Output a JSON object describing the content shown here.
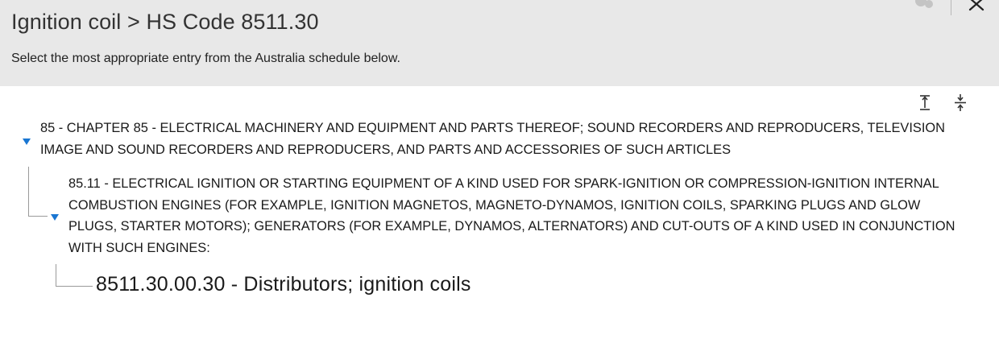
{
  "header": {
    "title": "Ignition coil > HS Code 8511.30",
    "subtitle": "Select the most appropriate entry from the Australia schedule below."
  },
  "icons": {
    "help": "help-icon",
    "close": "close-icon",
    "expand_all": "expand-all-icon",
    "collapse_all": "collapse-all-icon",
    "tree_toggle": "caret-down-icon"
  },
  "tree": {
    "chapter": {
      "label": "85 - CHAPTER 85 - ELECTRICAL MACHINERY AND EQUIPMENT AND PARTS THEREOF; SOUND RECORDERS AND REPRODUCERS, TELEVISION IMAGE AND SOUND RECORDERS AND REPRODUCERS, AND PARTS AND ACCESSORIES OF SUCH ARTICLES",
      "expanded": true
    },
    "heading": {
      "label": "85.11 - ELECTRICAL IGNITION OR STARTING EQUIPMENT OF A KIND USED FOR SPARK-IGNITION OR COMPRESSION-IGNITION INTERNAL COMBUSTION ENGINES (FOR EXAMPLE, IGNITION MAGNETOS, MAGNETO-DYNAMOS, IGNITION COILS, SPARKING PLUGS AND GLOW PLUGS, STARTER MOTORS); GENERATORS (FOR EXAMPLE, DYNAMOS, ALTERNATORS) AND CUT-OUTS OF A KIND USED IN CONJUNCTION WITH SUCH ENGINES:",
      "expanded": true
    },
    "leaf": {
      "label": "8511.30.00.30 - Distributors; ignition coils"
    }
  },
  "colors": {
    "header_bg": "#e8e8e8",
    "toggle": "#1976d2",
    "tree_line": "#9a9a9a"
  }
}
